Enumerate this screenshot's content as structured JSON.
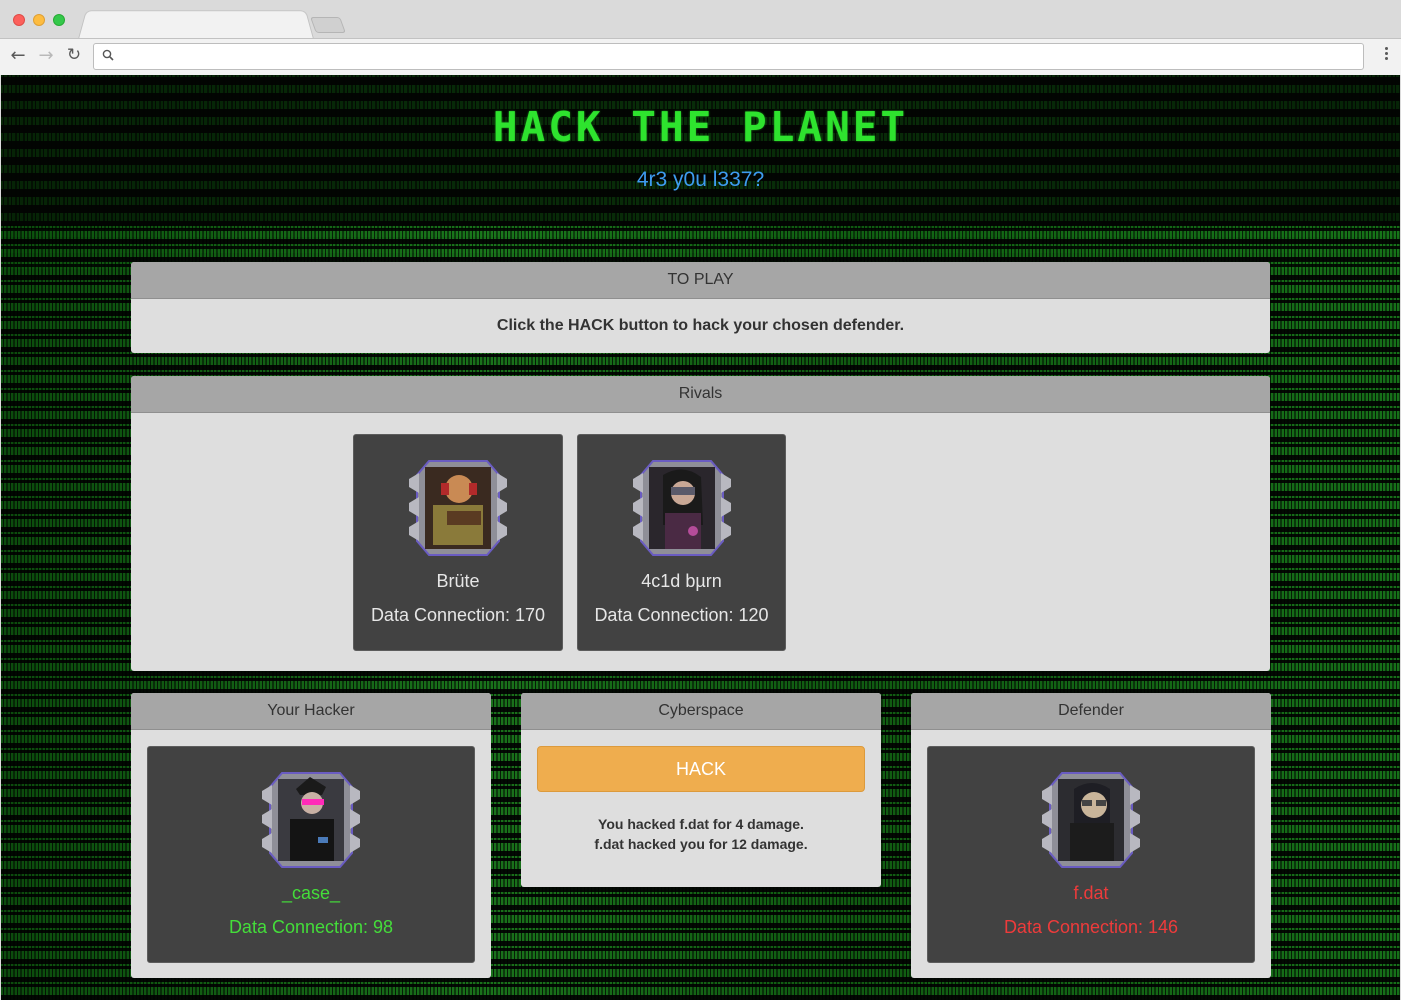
{
  "browser": {
    "url": "",
    "nav": {
      "back_icon": "arrow-left-icon",
      "forward_icon": "arrow-right-icon",
      "reload_icon": "reload-icon"
    }
  },
  "hero": {
    "title": "HACK THE PLANET",
    "subtitle": "4r3 y0u l337?"
  },
  "instructions": {
    "title": "TO PLAY",
    "text": "Click the HACK button to hack your chosen defender."
  },
  "rivals": {
    "title": "Rivals",
    "items": [
      {
        "name": "Brüte",
        "data_connection": "Data Connection: 170"
      },
      {
        "name": "4c1d bµrn",
        "data_connection": "Data Connection: 120"
      }
    ]
  },
  "your_hacker": {
    "title": "Your Hacker",
    "name": "_case_",
    "data_connection": "Data Connection: 98"
  },
  "cyberspace": {
    "title": "Cyberspace",
    "button_label": "HACK",
    "log": [
      "You hacked f.dat for 4 damage.",
      "f.dat hacked you for 12 damage."
    ]
  },
  "defender": {
    "title": "Defender",
    "name": "f.dat",
    "data_connection": "Data Connection: 146"
  },
  "colors": {
    "hero_title": "#2ee32e",
    "hero_subtitle": "#3e9cf0",
    "hacker_text": "#44dd3a",
    "defender_text": "#ee3b3b",
    "hack_button": "#efad4e",
    "panel_header": "#a6a6a6",
    "panel_body": "#dedede",
    "card": "#424242"
  }
}
